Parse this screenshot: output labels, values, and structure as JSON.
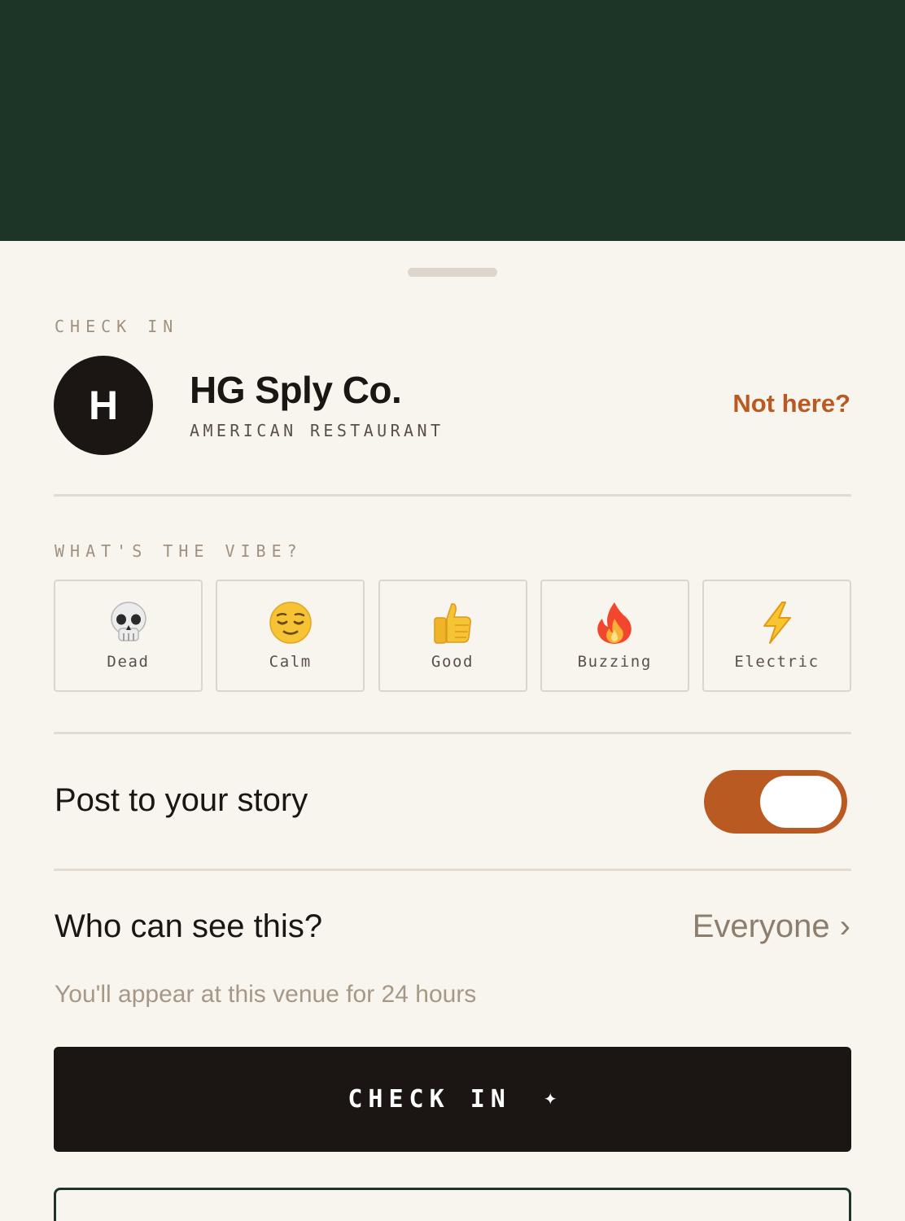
{
  "header": {
    "eyebrow": "CHECK IN"
  },
  "venue": {
    "initial": "H",
    "name": "HG Sply Co.",
    "category": "AMERICAN RESTAURANT",
    "not_here_label": "Not here?"
  },
  "vibe": {
    "heading": "WHAT'S THE VIBE?",
    "options": [
      {
        "label": "Dead",
        "icon": "skull-icon"
      },
      {
        "label": "Calm",
        "icon": "relieved-face-icon"
      },
      {
        "label": "Good",
        "icon": "thumbs-up-icon"
      },
      {
        "label": "Buzzing",
        "icon": "fire-icon"
      },
      {
        "label": "Electric",
        "icon": "lightning-icon"
      }
    ]
  },
  "story": {
    "label": "Post to your story",
    "enabled": true
  },
  "visibility": {
    "label": "Who can see this?",
    "value": "Everyone",
    "chevron": "›"
  },
  "note": "You'll appear at this venue for 24 hours",
  "cta": {
    "label": "CHECK IN",
    "sparkle": "✦"
  },
  "colors": {
    "brand_green": "#1c3526",
    "accent": "#b85a22",
    "ink": "#1b1613",
    "sheet": "#f8f4ee"
  }
}
